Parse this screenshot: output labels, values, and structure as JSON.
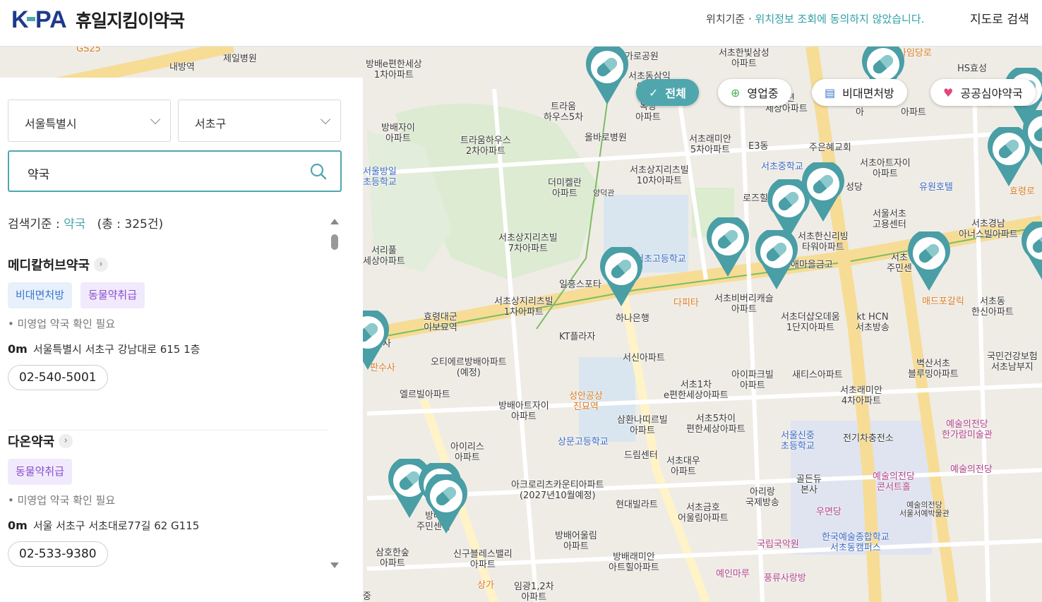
{
  "header": {
    "brand": "휴일지킴이약국",
    "location_prefix": "위치기준 · ",
    "location_notice": "위치정보 조회에 동의하지 않았습니다.",
    "map_search": "지도로 검색"
  },
  "filters": [
    {
      "label": "전체",
      "active": true,
      "icon": "check-icon"
    },
    {
      "label": "영업중",
      "active": false,
      "icon": "open-status-icon"
    },
    {
      "label": "비대면처방",
      "active": false,
      "icon": "remote-prescription-icon"
    },
    {
      "label": "공공심야약국",
      "active": false,
      "icon": "heart-pulse-icon"
    }
  ],
  "panel": {
    "city": "서울특별시",
    "district": "서초구",
    "search_value": "약국",
    "criteria_label": "검색기준 : ",
    "criteria_keyword": "약국",
    "criteria_total": "(총 : 325건)",
    "results": [
      {
        "name": "메디칼허브약국",
        "tags": [
          "비대면처방",
          "동물약취급"
        ],
        "status": "• 미영업   약국 확인 필요",
        "distance": "0m",
        "address": "서울특별시 서초구 강남대로 615 1층",
        "phone": "02-540-5001"
      },
      {
        "name": "다온약국",
        "tags": [
          "동물약취급"
        ],
        "status": "• 미영업   약국 확인 필요",
        "distance": "0m",
        "address": "서울 서초구 서초대로77길 62 G115",
        "phone": "02-533-9380"
      }
    ]
  },
  "map_labels": {
    "l01": "제일병원",
    "l02": "방배e편한세상\n1차아파트",
    "l03": "방배자이\n아파트",
    "l04": "트라움\n하우스5차",
    "l05": "트라움하우스\n2차아파트",
    "l06": "올바로병원",
    "l07": "가로공원",
    "l08": "서초동삼익\n아파트",
    "l09": "옥당\n아파트",
    "l10": "서초래미안\n5차아파트",
    "l11": "서초한빛삼성\n아파트",
    "l12": "HS효성",
    "l13": "서초중학교",
    "l14": "주은혜교회",
    "l15": "서초아트자이\n아파트",
    "l16": "유원호텔",
    "l17": "서초상지리츠빌\n10차아파트",
    "l18": "더미켈란\n아파트",
    "l19": "서초상지리츠빌\n7차아파트",
    "l20": "서초한신리빙\n타워아파트",
    "l21": "서울서초\n고용센터",
    "l22": "서초경남\n아너스빌아파트",
    "l23": "서울방일\n초등학교",
    "l24": "서리풀\n세상아파트",
    "l25": "서초고등학교",
    "l26": "일흥스포타",
    "l27": "서초상지리츠빌\n1차아파트",
    "l28": "효령대군\n이보묘역",
    "l29": "하나은행",
    "l30": "다피타",
    "l31": "서초비버리캐슬\n아파트",
    "l32": "서초더샵오데움\n1단지아파트",
    "l33": "kt HCN\n서초방송",
    "l34": "매드포갈릭",
    "l35": "서초동\n한신아파트",
    "l36": "KT플라자",
    "l37": "오티에르방배아파트\n(예정)",
    "l38": "엘르빌아파트",
    "l39": "서신아파트",
    "l40": "서초1차\ne편한세상아파트",
    "l41": "아이파크빌\n아파트",
    "l42": "새티스아파트",
    "l43": "서초래미안\n4차아파트",
    "l44": "벽산서초\n블루밍아파트",
    "l45": "국민건강보험\n서초남부지",
    "l46": "방배아트자이\n아파트",
    "l47": "성안공상\n진묘역",
    "l48": "삼환나띠르빌\n아파트",
    "l49": "서초5차이\n편한세상아파트",
    "l50": "상문고등학교",
    "l51": "서울신중\n초등학교",
    "l52": "전기차충전소",
    "l53": "예술의전당\n한가람미술관",
    "l54": "아이리스\n아파트",
    "l55": "드림센터",
    "l56": "서초대우\n아파트",
    "l57": "골든듀\n본사",
    "l58": "예술의전당\n콘서트홀",
    "l59": "예술의전당",
    "l60": "아크로리츠카운티아파트\n(2027년10월예정)",
    "l61": "현대빌라트",
    "l62": "아리랑\n국제방송",
    "l63": "우면당",
    "l64": "서초금호\n어울림아파트",
    "l65": "국립국악원",
    "l66": "한국예술종합학교\n서초동캠퍼스",
    "l67": "방배어울림\n아파트",
    "l68": "방배래미안\n아트힐아파트",
    "l69": "신구블레스밸리\n아파트",
    "l70": "삼호한숲\n아파트",
    "l71": "방배\n주민센터",
    "l72": "임광1,2차\n아파트",
    "l73": "예인마루",
    "l74": "풍류사랑방",
    "l75": "예술의전당\n서울서예박물관",
    "l76": "상가",
    "l77": "방배중",
    "l78": "내방역",
    "l79": "청권사",
    "l80": "판수사",
    "l81": "양덕관",
    "l82": "로즈힐",
    "l83": "애마을금고",
    "l84": "성당",
    "l85": "서초\n주민센",
    "l86": "효령로",
    "l87": "사임당로",
    "l88": "E3동",
    "l89": "GS25",
    "l90": "이편\n세상아파트",
    "l91": "아파트",
    "l92": "아"
  },
  "attribution": "kakao"
}
